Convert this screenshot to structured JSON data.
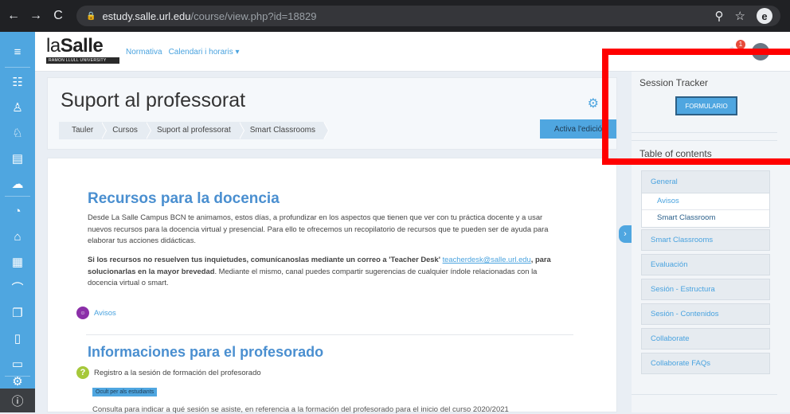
{
  "browser": {
    "url_domain": "estudy.salle.url.edu",
    "url_path": "/course/view.php?id=18829",
    "profile_initial": "e"
  },
  "navbar": {
    "logo_text_light": "la",
    "logo_text_bold": "Salle",
    "logo_subtitle": "RAMON LLULL UNIVERSITY",
    "links": [
      "Normativa",
      "Calendari i horaris ▾"
    ],
    "notification_count": "1"
  },
  "header": {
    "title": "Suport al professorat",
    "breadcrumbs": [
      "Tauler",
      "Cursos",
      "Suport al professorat",
      "Smart Classrooms"
    ],
    "edit_button": "Activa l'edició"
  },
  "content": {
    "section1_title": "Recursos para la docencia",
    "para1": "Desde La Salle Campus BCN te animamos, estos días, a profundizar en los aspectos que tienen que ver con tu práctica docente y a usar nuevos recursos para la docencia virtual y presencial. Para ello te ofrecemos un recopilatorio de recursos que te pueden ser de ayuda para elaborar tus acciones didácticas.",
    "para2_bold": "Si los recursos no resuelven tus inquietudes, comunícanoslas mediante un correo a 'Teacher Desk'",
    "para2_link": "teacherdesk@salle.url.edu",
    "para2_bold2": "para solucionarlas en la mayor brevedad",
    "para2_rest": ". Mediante el mismo, canal puedes compartir sugerencias de cualquier índole relacionadas con la docencia virtual o smart.",
    "avisos_label": "Avisos",
    "section2_title": "Informaciones para el profesorado",
    "registro_label": "Registro a la sesión de formación del profesorado",
    "hidden_badge": "Ocult per als estudiants",
    "cut_text": "Consulta para indicar a qué sesión se asiste, en referencia a la formación del profesorado para el inicio del curso 2020/2021"
  },
  "drawer": {
    "session_title": "Session Tracker",
    "form_button": "FORMULARIO",
    "toc_title": "Table of contents",
    "general": "General",
    "general_subitems": [
      "Avisos",
      "Smart Classroom"
    ],
    "toc_items": [
      "Smart Classrooms",
      "Evaluación",
      "Sesión - Estructura",
      "Sesión - Contenidos",
      "Collaborate",
      "Collaborate FAQs"
    ]
  },
  "colors": {
    "accent": "#4fa6e0",
    "highlight": "#ff0000"
  }
}
